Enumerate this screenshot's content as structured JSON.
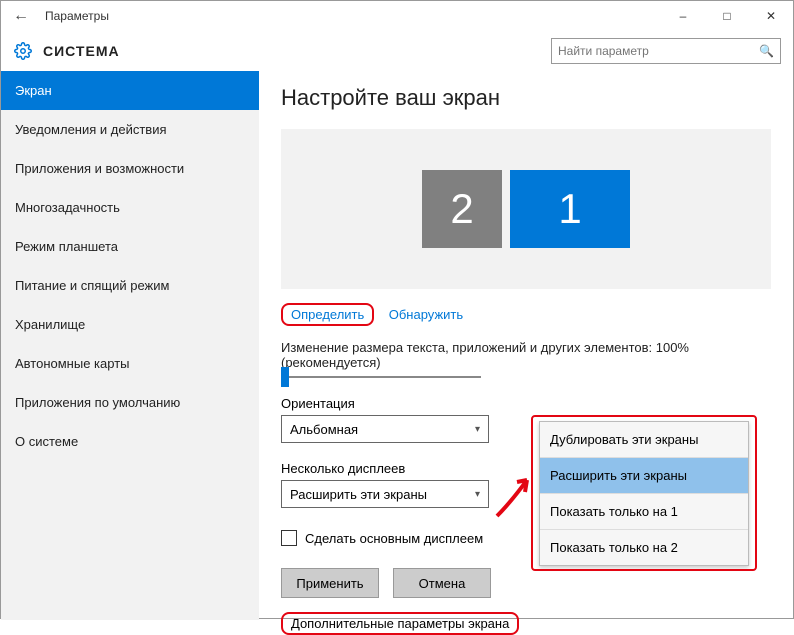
{
  "window": {
    "title": "Параметры"
  },
  "header": {
    "section": "СИСТЕМА",
    "search_placeholder": "Найти параметр"
  },
  "sidebar": {
    "items": [
      {
        "label": "Экран",
        "active": true
      },
      {
        "label": "Уведомления и действия"
      },
      {
        "label": "Приложения и возможности"
      },
      {
        "label": "Многозадачность"
      },
      {
        "label": "Режим планшета"
      },
      {
        "label": "Питание и спящий режим"
      },
      {
        "label": "Хранилище"
      },
      {
        "label": "Автономные карты"
      },
      {
        "label": "Приложения по умолчанию"
      },
      {
        "label": "О системе"
      }
    ]
  },
  "main": {
    "title": "Настройте ваш экран",
    "monitor2": "2",
    "monitor1": "1",
    "identify": "Определить",
    "detect": "Обнаружить",
    "scale_label": "Изменение размера текста, приложений и других элементов: 100% (рекомендуется)",
    "orientation_label": "Ориентация",
    "orientation_value": "Альбомная",
    "multi_label": "Несколько дисплеев",
    "multi_value": "Расширить эти экраны",
    "primary_checkbox": "Сделать основным дисплеем",
    "apply_btn": "Применить",
    "cancel_btn": "Отмена",
    "advanced_link": "Дополнительные параметры экрана"
  },
  "dropdown": {
    "opt1": "Дублировать эти экраны",
    "opt2": "Расширить эти экраны",
    "opt3": "Показать только на 1",
    "opt4": "Показать только на 2"
  }
}
